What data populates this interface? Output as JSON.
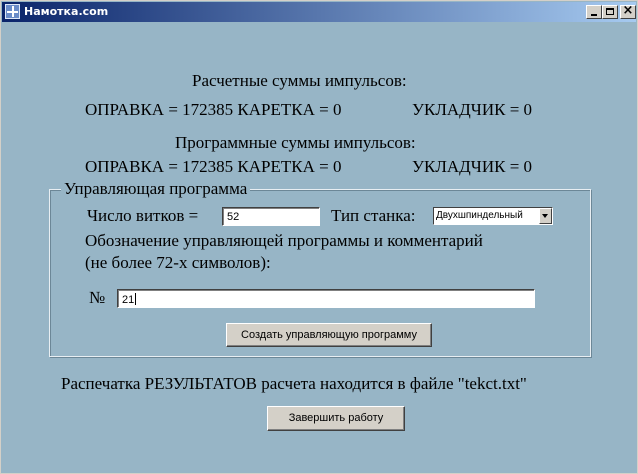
{
  "window": {
    "title": "Намотка.com",
    "controls": {
      "minimize": "_",
      "maximize": "□",
      "close": "×"
    }
  },
  "calculated": {
    "heading": "Расчетные суммы импульсов:",
    "line": "ОПРАВКА = 172385 КАРЕТКА = 0",
    "ukladchik": "УКЛАДЧИК = 0"
  },
  "programmed": {
    "heading": "Программные суммы импульсов:",
    "line": "ОПРАВКА = 172385 КАРЕТКА = 0",
    "ukladchik": "УКЛАДЧИК = 0"
  },
  "control_program": {
    "legend": "Управляющая программа",
    "turns_label": "Число витков =",
    "turns_value": "52",
    "machine_type_label": "Тип станка:",
    "machine_type_selected": "Двухшпиндельный",
    "designation_line1": "Обозначение управляющей программы и комментарий",
    "designation_line2": "(не более 72-х символов):",
    "number_label": "№",
    "number_value": "21",
    "create_button": "Создать управляющую программу"
  },
  "footer": {
    "results_text": "Распечатка РЕЗУЛЬТАТОВ расчета находится в файле \"tekct.txt\"",
    "finish_button": "Завершить работу"
  }
}
